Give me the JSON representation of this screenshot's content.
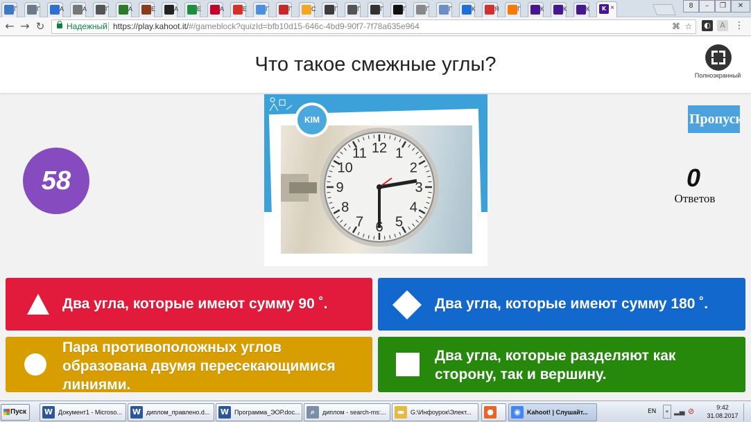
{
  "browser": {
    "tab_titles": [
      "Г",
      "Г",
      "А",
      "А",
      "Г",
      "А",
      "Е",
      "А",
      "Е",
      "А",
      "Е",
      "Г",
      "Г",
      "С",
      "Г",
      "Г",
      "Г",
      "Г",
      "Г",
      "Г",
      "К",
      "Я",
      "Г",
      "К",
      "К",
      "К"
    ],
    "active_tab_title": "К",
    "secure_label": "Надежный",
    "url_host": "https://play.kahoot.it/",
    "url_path": "#/gameblock?quizId=bfb10d15-646c-4bd9-90f7-7f78a635e964",
    "window_buttons": [
      "8",
      "–",
      "❐",
      "✕"
    ]
  },
  "game": {
    "question": "Что такое смежные углы?",
    "fullscreen_label": "Полноэкранный",
    "timer": "58",
    "media_badge": "KIM",
    "clock_numbers": [
      "12",
      "1",
      "2",
      "3",
      "4",
      "5",
      "6",
      "7",
      "8",
      "9",
      "10",
      "11"
    ],
    "skip_label": "Пропуск",
    "answers_count": "0",
    "answers_label": "Ответов",
    "answers": [
      {
        "shape": "triangle",
        "text": "Два угла, которые имеют сумму 90 ˚.",
        "color": "#e21b3c"
      },
      {
        "shape": "diamond",
        "text": "Два угла, которые имеют сумму 180 ˚.",
        "color": "#1368ce"
      },
      {
        "shape": "circle",
        "text": "Пара противоположных углов образована двумя пересекающимися линиями.",
        "color": "#d89e00"
      },
      {
        "shape": "square",
        "text": "Два угла, которые разделяют как сторону, так и вершину.",
        "color": "#26890c"
      }
    ]
  },
  "taskbar": {
    "start_label": "Пуск",
    "tasks": [
      {
        "label": "Документ1 - Microso...",
        "icon": "word-icon"
      },
      {
        "label": "диплом_правлено.d...",
        "icon": "word-icon"
      },
      {
        "label": "Программа_ЭОР.doc...",
        "icon": "word-icon"
      },
      {
        "label": "диплом - search-ms:...",
        "icon": "search-icon"
      },
      {
        "label": "G:\\Инфоурок\\Элект...",
        "icon": "folder-icon"
      },
      {
        "label": "",
        "icon": "firefox-icon"
      },
      {
        "label": "Kahoot! | Слушайт...",
        "icon": "chrome-icon"
      }
    ],
    "language": "EN",
    "time": "9:42",
    "date": "31.08.2017"
  }
}
